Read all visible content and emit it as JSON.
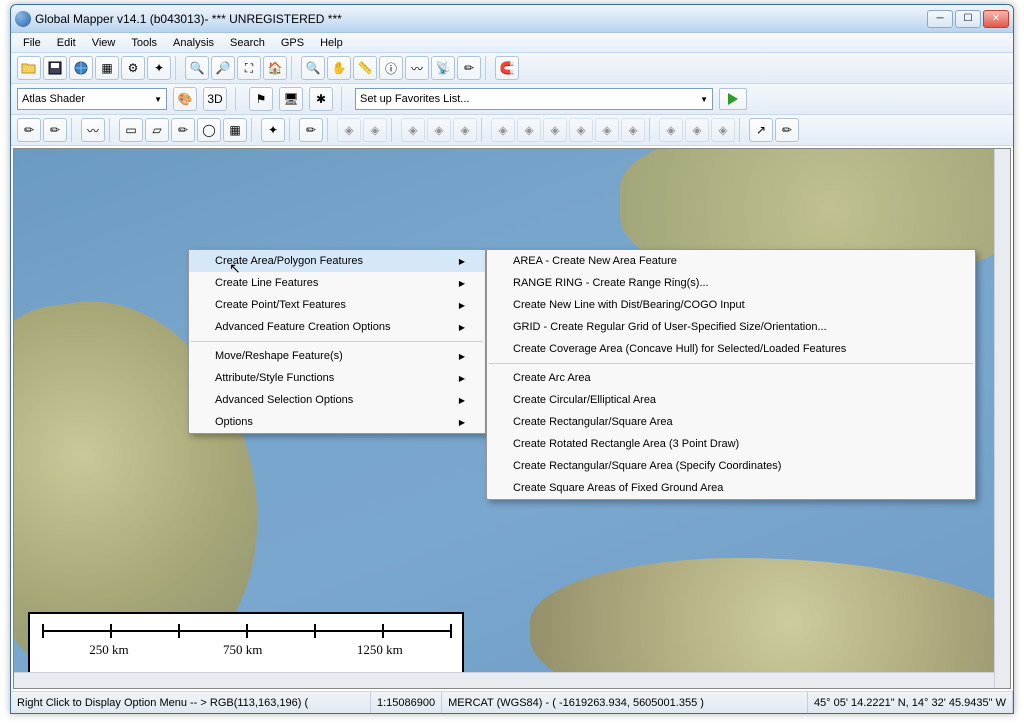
{
  "title": "Global Mapper v14.1 (b043013)- *** UNREGISTERED ***",
  "menu": [
    "File",
    "Edit",
    "View",
    "Tools",
    "Analysis",
    "Search",
    "GPS",
    "Help"
  ],
  "shader_value": "Atlas Shader",
  "favorites_value": "Set up Favorites List...",
  "context_main": [
    {
      "label": "Create Area/Polygon Features",
      "sub": true,
      "hl": true
    },
    {
      "label": "Create Line Features",
      "sub": true
    },
    {
      "label": "Create Point/Text Features",
      "sub": true
    },
    {
      "label": "Advanced Feature Creation Options",
      "sub": true
    },
    {
      "sep": true
    },
    {
      "label": "Move/Reshape Feature(s)",
      "sub": true
    },
    {
      "label": "Attribute/Style Functions",
      "sub": true
    },
    {
      "label": "Advanced Selection Options",
      "sub": true
    },
    {
      "label": "Options",
      "sub": true
    }
  ],
  "context_sub": [
    {
      "label": "AREA - Create New Area Feature"
    },
    {
      "label": "RANGE RING - Create Range Ring(s)..."
    },
    {
      "label": "Create New Line with Dist/Bearing/COGO Input"
    },
    {
      "label": "GRID - Create Regular Grid of User-Specified Size/Orientation..."
    },
    {
      "label": "Create Coverage Area (Concave Hull) for Selected/Loaded Features"
    },
    {
      "sep": true
    },
    {
      "label": "Create Arc Area"
    },
    {
      "label": "Create Circular/Elliptical Area"
    },
    {
      "label": "Create Rectangular/Square Area"
    },
    {
      "label": "Create Rotated Rectangle Area (3 Point Draw)"
    },
    {
      "label": "Create Rectangular/Square Area (Specify Coordinates)"
    },
    {
      "label": "Create Square Areas of Fixed Ground Area"
    }
  ],
  "scale_labels": [
    "250 km",
    "750 km",
    "1250 km"
  ],
  "status": {
    "hint": "Right Click to Display Option Menu -- >  RGB(113,163,196) (",
    "scale": "1:15086900",
    "proj": "MERCAT  (WGS84) - ( -1619263.934, 5605001.355 )",
    "coords": "45° 05' 14.2221\" N, 14° 32' 45.9435\" W"
  }
}
